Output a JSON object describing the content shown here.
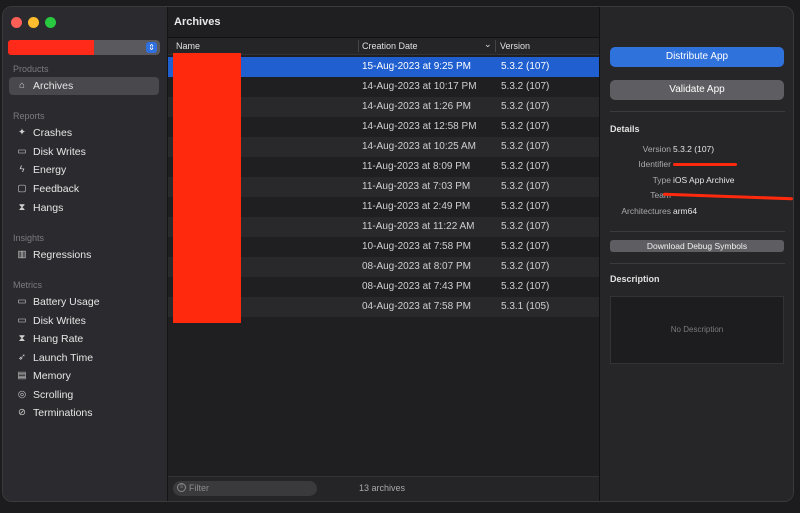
{
  "sidebar": {
    "sections": [
      {
        "title": "Products",
        "items": [
          {
            "label": "Archives",
            "icon": "archive-icon",
            "glyph": "⌂"
          }
        ]
      },
      {
        "title": "Reports",
        "items": [
          {
            "label": "Crashes",
            "icon": "crash-icon",
            "glyph": "✦"
          },
          {
            "label": "Disk Writes",
            "icon": "disk-icon",
            "glyph": "▭"
          },
          {
            "label": "Energy",
            "icon": "energy-icon",
            "glyph": "ϟ"
          },
          {
            "label": "Feedback",
            "icon": "feedback-icon",
            "glyph": "▢"
          },
          {
            "label": "Hangs",
            "icon": "hourglass-icon",
            "glyph": "⧗"
          }
        ]
      },
      {
        "title": "Insights",
        "items": [
          {
            "label": "Regressions",
            "icon": "regressions-icon",
            "glyph": "▥"
          }
        ]
      },
      {
        "title": "Metrics",
        "items": [
          {
            "label": "Battery Usage",
            "icon": "battery-icon",
            "glyph": "▭"
          },
          {
            "label": "Disk Writes",
            "icon": "disk-icon",
            "glyph": "▭"
          },
          {
            "label": "Hang Rate",
            "icon": "hourglass-icon",
            "glyph": "⧗"
          },
          {
            "label": "Launch Time",
            "icon": "rocket-icon",
            "glyph": "➶"
          },
          {
            "label": "Memory",
            "icon": "memory-icon",
            "glyph": "▤"
          },
          {
            "label": "Scrolling",
            "icon": "scrolling-icon",
            "glyph": "◎"
          },
          {
            "label": "Terminations",
            "icon": "terminations-icon",
            "glyph": "⊘"
          }
        ]
      }
    ]
  },
  "main": {
    "title": "Archives",
    "columns": {
      "name": "Name",
      "date": "Creation Date",
      "version": "Version",
      "sort_glyph": "⌄"
    },
    "rows": [
      {
        "date": "15-Aug-2023 at 9:25 PM",
        "version": "5.3.2 (107)"
      },
      {
        "date": "14-Aug-2023 at 10:17 PM",
        "version": "5.3.2 (107)"
      },
      {
        "date": "14-Aug-2023 at 1:26 PM",
        "version": "5.3.2 (107)"
      },
      {
        "date": "14-Aug-2023 at 12:58 PM",
        "version": "5.3.2 (107)"
      },
      {
        "date": "14-Aug-2023 at 10:25 AM",
        "version": "5.3.2 (107)"
      },
      {
        "date": "11-Aug-2023 at 8:09 PM",
        "version": "5.3.2 (107)"
      },
      {
        "date": "11-Aug-2023 at 7:03 PM",
        "version": "5.3.2 (107)"
      },
      {
        "date": "11-Aug-2023 at 2:49 PM",
        "version": "5.3.2 (107)"
      },
      {
        "date": "11-Aug-2023 at 11:22 AM",
        "version": "5.3.2 (107)"
      },
      {
        "date": "10-Aug-2023 at 7:58 PM",
        "version": "5.3.2 (107)"
      },
      {
        "date": "08-Aug-2023 at 8:07 PM",
        "version": "5.3.2 (107)"
      },
      {
        "date": "08-Aug-2023 at 7:43 PM",
        "version": "5.3.2 (107)"
      },
      {
        "date": "04-Aug-2023 at 7:58 PM",
        "version": "5.3.1 (105)"
      }
    ],
    "filter_placeholder": "Filter",
    "count": "13 archives"
  },
  "right": {
    "distribute_label": "Distribute App",
    "validate_label": "Validate App",
    "details_title": "Details",
    "version_key": "Version",
    "version_value": "5.3.2 (107)",
    "identifier_key": "Identifier",
    "type_key": "Type",
    "type_value": "iOS App Archive",
    "team_key": "Team",
    "arch_key": "Architectures",
    "arch_value": "arm64",
    "debug_label": "Download Debug Symbols",
    "description_title": "Description",
    "no_description": "No Description"
  },
  "colors": {
    "accent": "#2f72dc",
    "selection": "#1f5fd0",
    "redaction": "#ff2a0e"
  }
}
